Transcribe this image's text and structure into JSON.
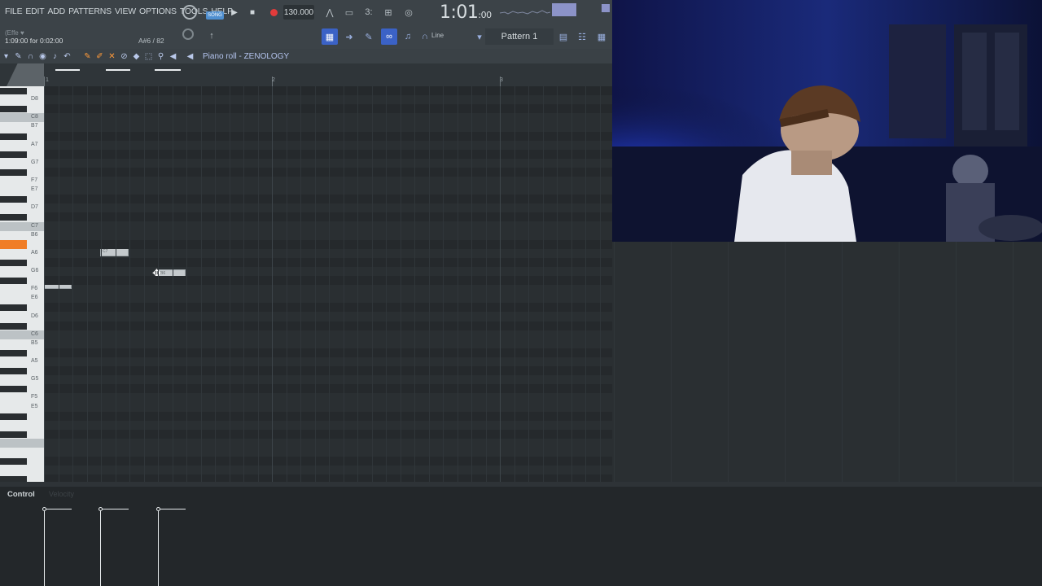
{
  "menu": [
    "FILE",
    "EDIT",
    "ADD",
    "PATTERNS",
    "VIEW",
    "OPTIONS",
    "TOOLS",
    "HELP"
  ],
  "hint": {
    "small": "(Effe ♥",
    "time": "1:09:00 for 0:02:00"
  },
  "note_readout": "A#6 / 82",
  "transport": {
    "song_label": "SONG",
    "tempo": "130.000"
  },
  "time_display": {
    "main": "1:01",
    "sub": ":00"
  },
  "toolbar_icons": [
    "stepseq-icon",
    "arrow-right-icon",
    "pencil-icon",
    "link-icon",
    "bell-icon",
    "magnet-icon"
  ],
  "line_mode": "Line",
  "pattern": "Pattern 1",
  "piano_roll": {
    "title": "Piano roll - ZENOLOGY",
    "ruler_numbers": [
      "1",
      "2",
      "3"
    ]
  },
  "keys": {
    "labels": [
      "D8",
      "C8",
      "B7",
      "A7",
      "G7",
      "F7",
      "E7",
      "D7",
      "C7",
      "B6",
      "A6",
      "G6",
      "F6",
      "E6",
      "D6",
      "C6",
      "B5",
      "A5",
      "G5",
      "F5",
      "E5"
    ]
  },
  "notes": [
    {
      "label": "A6"
    },
    {
      "label": "C7"
    },
    {
      "label": "B6"
    }
  ],
  "control": {
    "label": "Control",
    "param": "Velocity"
  },
  "colors": {
    "accent": "#3b62c6",
    "active_key": "#f07d26",
    "record": "#e23b3b"
  }
}
